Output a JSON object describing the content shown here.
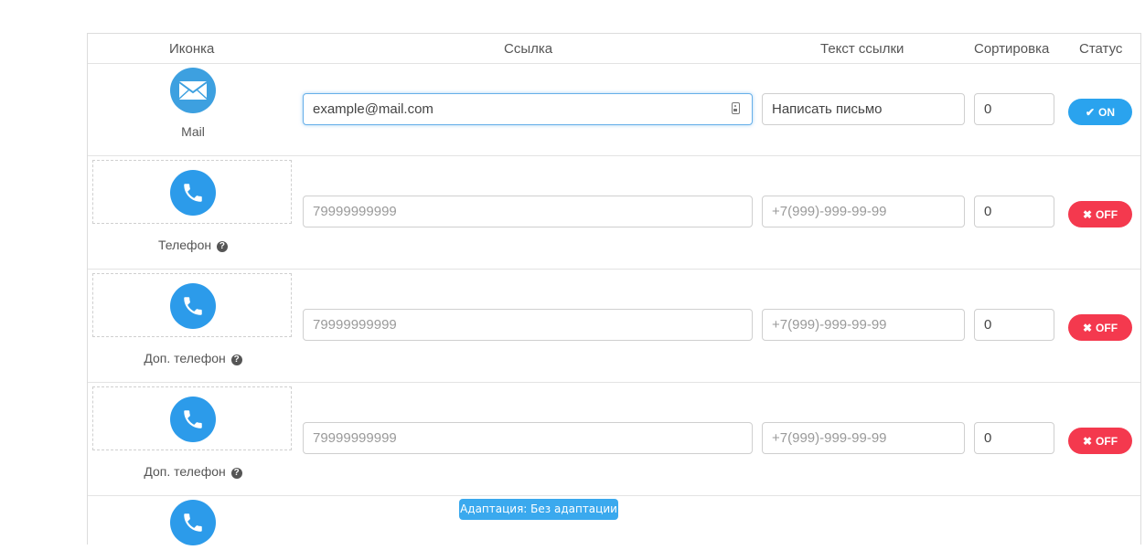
{
  "header": {
    "col_icon": "Иконка",
    "col_link": "Ссылка",
    "col_link_text": "Текст ссылки",
    "col_sort": "Сортировка",
    "col_status": "Статус"
  },
  "rows": [
    {
      "icon": "envelope-icon",
      "label": "Mail",
      "has_help": false,
      "link_value": "example@mail.com",
      "link_placeholder": "",
      "text_value": "Написать письмо",
      "text_placeholder": "",
      "sort_value": "0",
      "status": "ON",
      "status_color": "#2aa3ee"
    },
    {
      "icon": "phone-icon",
      "label": "Телефон",
      "has_help": true,
      "link_value": "",
      "link_placeholder": "79999999999",
      "text_value": "",
      "text_placeholder": "+7(999)-999-99-99",
      "sort_value": "0",
      "status": "OFF",
      "status_color": "#f4394e"
    },
    {
      "icon": "phone-icon",
      "label": "Доп. телефон",
      "has_help": true,
      "link_value": "",
      "link_placeholder": "79999999999",
      "text_value": "",
      "text_placeholder": "+7(999)-999-99-99",
      "sort_value": "0",
      "status": "OFF",
      "status_color": "#f4394e"
    },
    {
      "icon": "phone-icon",
      "label": "Доп. телефон",
      "has_help": true,
      "link_value": "",
      "link_placeholder": "79999999999",
      "text_value": "",
      "text_placeholder": "+7(999)-999-99-99",
      "sort_value": "0",
      "status": "OFF",
      "status_color": "#f4394e"
    }
  ],
  "adaptation_badge": "Адаптация: Без адаптации",
  "colors": {
    "accent_blue": "#2c9bea",
    "on_blue": "#2aa3ee",
    "off_red": "#f4394e"
  }
}
